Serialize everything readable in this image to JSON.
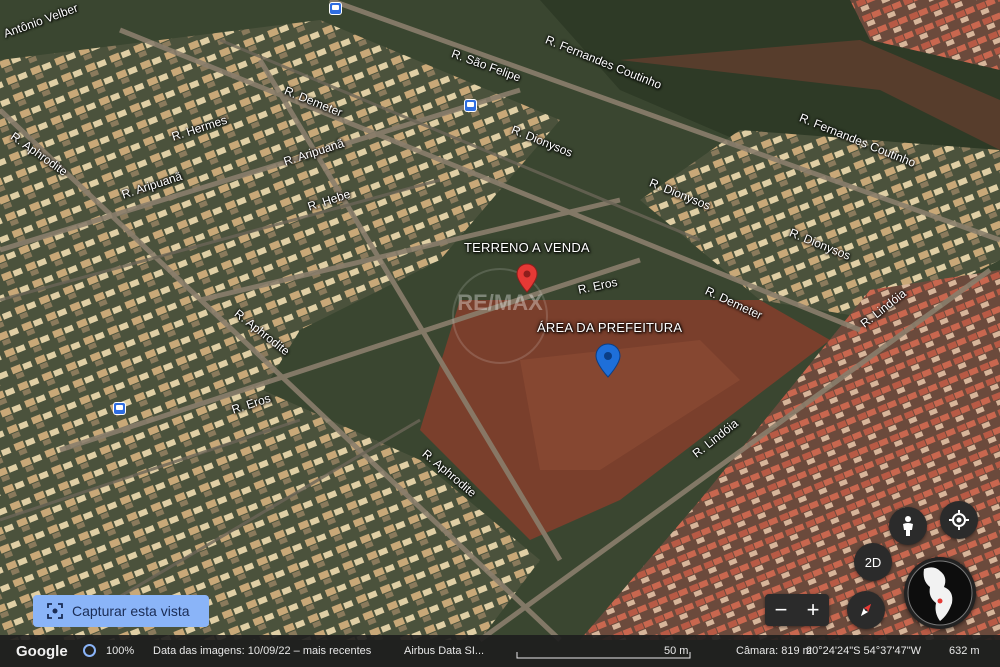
{
  "map": {
    "roads": [
      {
        "name": "R. Antônio Velber",
        "text": "Antônio Velber"
      },
      {
        "name": "R. São Felipe",
        "text": "R. São Felipe"
      },
      {
        "name": "R. Fernandes Coutinho top",
        "text": "R. Fernandes Coutinho"
      },
      {
        "name": "R. Fernandes Coutinho right",
        "text": "R. Fernandes Coutinho"
      },
      {
        "name": "R. Demeter top",
        "text": "R. Demeter"
      },
      {
        "name": "R. Aphrodite top",
        "text": "R. Aphrodite"
      },
      {
        "name": "R. Hermes",
        "text": "R. Hermes"
      },
      {
        "name": "R. Aripuanã upper",
        "text": "R. Aripuanã"
      },
      {
        "name": "R. Aripuanã lower",
        "text": "R. Aripuanã"
      },
      {
        "name": "R. Dionysos top",
        "text": "R. Dionysos"
      },
      {
        "name": "R. Dionysos mid",
        "text": "R. Dionysos"
      },
      {
        "name": "R. Dionysos right",
        "text": "R. Dionysos"
      },
      {
        "name": "R. Hebe",
        "text": "R. Hebe"
      },
      {
        "name": "R. Eros mid",
        "text": "R. Eros"
      },
      {
        "name": "R. Demeter right",
        "text": "R. Demeter"
      },
      {
        "name": "R. Lindóia upper",
        "text": "R. Lindóia"
      },
      {
        "name": "R. Aphrodite mid",
        "text": "R. Aphrodite"
      },
      {
        "name": "R. Eros left",
        "text": "R. Eros"
      },
      {
        "name": "R. Aphrodite lower",
        "text": "R. Aphrodite"
      },
      {
        "name": "R. Lindóia lower",
        "text": "R. Lindóia"
      }
    ],
    "places": {
      "terreno": "TERRENO A VENDA",
      "prefeitura": "ÁREA DA PREFEITURA"
    },
    "watermark": "RE/MAX",
    "colors": {
      "red_pin": "#e53935",
      "blue_pin": "#1e6fd9"
    }
  },
  "controls": {
    "capture_label": "Capturar esta vista",
    "view_mode": "2D",
    "zoom_out": "−",
    "zoom_in": "+"
  },
  "status_bar": {
    "brand": "Google",
    "zoom": "100%",
    "imagery_date": "Data das imagens: 10/09/22 – mais recentes",
    "attribution": "Airbus   Data SI...",
    "scale": "50 m",
    "camera": "Câmara: 819 m",
    "coords": "20°24'24\"S 54°37'47\"W",
    "altitude": "632 m"
  }
}
